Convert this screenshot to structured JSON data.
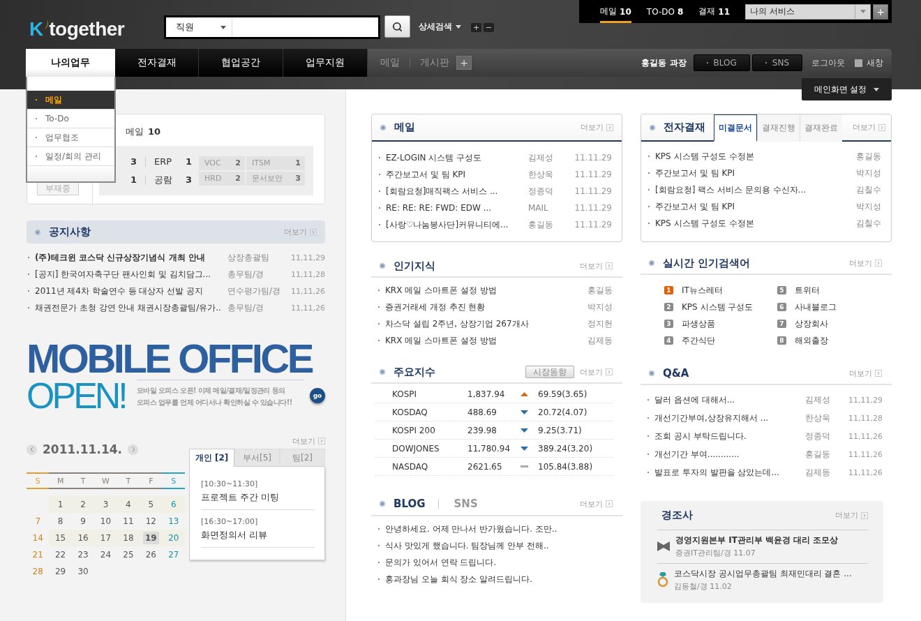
{
  "header": {
    "logo": {
      "mark": "K",
      "name": "together"
    },
    "search": {
      "scope": "직원"
    },
    "detail_search": "상세검색",
    "zoom_buttons": [
      "+",
      "−"
    ],
    "counters": [
      {
        "label": "메일",
        "count": "10",
        "selected": true
      },
      {
        "label": "TO-DO",
        "count": "8",
        "selected": false
      },
      {
        "label": "결재",
        "count": "11",
        "selected": false
      }
    ],
    "service_select": "나의 서비스",
    "service_add": "+"
  },
  "nav": {
    "tabs": [
      {
        "label": "나의업무",
        "selected": true
      },
      {
        "label": "전자결재",
        "selected": false
      },
      {
        "label": "협업공간",
        "selected": false
      },
      {
        "label": "업무지원",
        "selected": false
      }
    ],
    "quick_links": [
      "메일",
      "게시판"
    ],
    "quick_add": "+",
    "user": "홍길동 과장",
    "user_buttons": [
      "BLOG",
      "SNS"
    ],
    "logout": "로그아웃",
    "new_window": {
      "label": "새창",
      "checked": false
    },
    "main_settings": "메인화면 설정"
  },
  "dropdown": {
    "items": [
      {
        "label": "메일",
        "selected": true
      },
      {
        "label": "To-Do",
        "selected": false
      },
      {
        "label": "업무협조",
        "selected": false
      },
      {
        "label": "일정/회의 관리",
        "selected": false
      }
    ]
  },
  "mail_summary": {
    "title": "메일",
    "count": "10",
    "away_button": "부재중",
    "stats": [
      [
        {
          "value": "3"
        },
        {
          "label": "ERP",
          "value": "1"
        }
      ],
      [
        {
          "value": "1"
        },
        {
          "label": "공람",
          "value": "3"
        }
      ]
    ],
    "boxes": [
      {
        "label": "VOC",
        "value": "2"
      },
      {
        "label": "ITSM",
        "value": "1"
      },
      {
        "label": "HRD",
        "value": "2"
      },
      {
        "label": "문서보안",
        "value": "3"
      }
    ]
  },
  "notices": {
    "title": "공지사항",
    "more": "더보기",
    "rows": [
      {
        "title": "(주)테크윈 코스닥 신규상장기념식 개최 안내",
        "dept": "상장총괄팀",
        "date": "11,11,29",
        "bold": true
      },
      {
        "title": "[공지] 한국여자축구단 팬사인회 및 김치담그...",
        "dept": "총무팀/경",
        "date": "11,11,28",
        "bold": false
      },
      {
        "title": "2011년 제4차 학술연수 등 대상자 선발 공지",
        "dept": "연수평가팀/경",
        "date": "11,11,26",
        "bold": false
      },
      {
        "title": "채권전문가 초청 강연 안내 채권시장총괄팀/유가..",
        "dept": "총무팀/경",
        "date": "11,11,26",
        "bold": false
      }
    ]
  },
  "banner": {
    "headline": "MOBILE OFFICE",
    "subhead": "OPEN!",
    "lines": [
      "모바일 오피스 오픈! 이제 메일/결재/일정관리 등의",
      "오피스 업무를 언제 어디서나 확인하실 수 있습니다!!"
    ],
    "go": "go"
  },
  "calendar": {
    "date": "2011.11.14.",
    "more": "더보기",
    "weekdays": [
      {
        "label": "S",
        "kind": "sun"
      },
      {
        "label": "M",
        "kind": "day"
      },
      {
        "label": "T",
        "kind": "day"
      },
      {
        "label": "W",
        "kind": "day"
      },
      {
        "label": "T",
        "kind": "day"
      },
      {
        "label": "F",
        "kind": "day"
      },
      {
        "label": "S",
        "kind": "sat"
      }
    ],
    "weeks": [
      {
        "shaded": true,
        "days": [
          {
            "day": "1",
            "today": false
          },
          {
            "day": "2",
            "today": false
          },
          {
            "day": "3",
            "today": false
          },
          {
            "day": "4",
            "today": false
          },
          {
            "day": "5",
            "today": false
          },
          {
            "day": "6",
            "today": false
          }
        ]
      },
      {
        "shaded": false,
        "days": [
          {
            "day": "7",
            "today": false
          },
          {
            "day": "8",
            "today": false
          },
          {
            "day": "9",
            "today": false
          },
          {
            "day": "10",
            "today": false
          },
          {
            "day": "11",
            "today": false
          },
          {
            "day": "12",
            "today": false
          },
          {
            "day": "13",
            "today": false
          }
        ]
      },
      {
        "shaded": true,
        "days": [
          {
            "day": "14",
            "today": false
          },
          {
            "day": "15",
            "today": false
          },
          {
            "day": "16",
            "today": false
          },
          {
            "day": "17",
            "today": false
          },
          {
            "day": "18",
            "today": false
          },
          {
            "day": "19",
            "today": true
          },
          {
            "day": "20",
            "today": false
          }
        ]
      },
      {
        "shaded": false,
        "days": [
          {
            "day": "21",
            "today": false
          },
          {
            "day": "22",
            "today": false
          },
          {
            "day": "23",
            "today": false
          },
          {
            "day": "24",
            "today": false
          },
          {
            "day": "25",
            "today": false
          },
          {
            "day": "26",
            "today": false
          },
          {
            "day": "27",
            "today": false
          }
        ]
      },
      {
        "shaded": false,
        "days": [
          {
            "day": "28",
            "today": false
          },
          {
            "day": "29",
            "today": false
          },
          {
            "day": "30",
            "today": false
          }
        ]
      }
    ]
  },
  "schedule": {
    "tabs": [
      {
        "label": "개인 [2]",
        "selected": true
      },
      {
        "label": "부서[5]",
        "selected": false
      },
      {
        "label": "팀[2]",
        "selected": false
      }
    ],
    "events": [
      {
        "time": "[10:30~11:30]",
        "title": "프로젝트 주간 미팅"
      },
      {
        "time": "[16:30~17:00]",
        "title": "화면정의서 리뷰"
      }
    ]
  },
  "mail": {
    "title": "메일",
    "more": "더보기",
    "rows": [
      {
        "title": "EZ-LOGIN 시스템 구성도",
        "sender": "김제성",
        "date": "11.11.29"
      },
      {
        "title": "주간보고서 및 팀 KPI",
        "sender": "한상욱",
        "date": "11.11.29"
      },
      {
        "title": "[회람요청]매직팩스 서비스  ...",
        "sender": "정종덕",
        "date": "11.11.29"
      },
      {
        "title": "RE: RE: RE: FWD: EDW ...",
        "sender": "MAIL",
        "date": "11.11.29"
      },
      {
        "title": "[사랑♡나눔봉사단]커뮤니티에...",
        "sender": "홍길동",
        "date": "11.11.29"
      }
    ]
  },
  "knowledge": {
    "title": "인기지식",
    "more": "더보기",
    "rows": [
      {
        "title": "KRX 메일 스마트폰 설정 방법",
        "author": "홍길동"
      },
      {
        "title": "증권거래세 개정 추진 현황",
        "author": "박지성"
      },
      {
        "title": "차스닥 설립 2주년, 상장기업 267개사",
        "author": "정지헌"
      },
      {
        "title": "KRX 메일 스마트폰 설정 방법",
        "author": "김제동"
      }
    ]
  },
  "indices": {
    "title": "주요지수",
    "button": "시장동향",
    "more": "더보기",
    "rows": [
      {
        "name": "KOSPI",
        "value": "1,837.94",
        "kind": "up",
        "change": "69.59(3.65)"
      },
      {
        "name": "KOSDAQ",
        "value": "488.69",
        "kind": "down",
        "change": "20.72(4.07)"
      },
      {
        "name": "KOSPI 200",
        "value": "239.98",
        "kind": "down",
        "change": "9.25(3.71)"
      },
      {
        "name": "DOWJONES",
        "value": "11,780.94",
        "kind": "down",
        "change": "389.24(3.20)"
      },
      {
        "name": "NASDAQ",
        "value": "2621.65",
        "kind": "flat",
        "change": "105.84(3.88)"
      }
    ]
  },
  "social": {
    "tabs": [
      {
        "label": "BLOG",
        "selected": true
      },
      {
        "label": "SNS",
        "selected": false
      }
    ],
    "more": "더보기",
    "rows": [
      "안녕하세요. 어제 만나서 반가웠습니다. 조만..",
      "식사 맛있게 했습니다. 팀장님께 안부 전해..",
      "문의가 있어서 연락 드립니다.",
      "홍과장님 오늘 회식 장소 알려드립니다."
    ]
  },
  "approval": {
    "title": "전자결재",
    "tabs": [
      {
        "label": "미결문서",
        "selected": true
      },
      {
        "label": "결재진행",
        "selected": false
      },
      {
        "label": "결재완료",
        "selected": false
      }
    ],
    "more": "더보기",
    "rows": [
      {
        "title": "KPS 시스템 구성도 수정본",
        "name": "홍길동"
      },
      {
        "title": "주간보고서 및 팀 KPI",
        "name": "박지성"
      },
      {
        "title": "[회람요청] 팩스 서비스 문의용 수신자...",
        "name": "김칠수"
      },
      {
        "title": "주간보고서 및 팀 KPI",
        "name": "박지성"
      },
      {
        "title": "KPS 시스템 구성도 수정본",
        "name": "김칠수"
      }
    ]
  },
  "trending": {
    "title": "실시간 인기검색어",
    "more": "더보기",
    "items": [
      {
        "rank": "1",
        "term": "IT뉴스레터",
        "highlighted": true
      },
      {
        "rank": "2",
        "term": "KPS 시스템 구성도",
        "highlighted": false
      },
      {
        "rank": "3",
        "term": "파생상품",
        "highlighted": false
      },
      {
        "rank": "4",
        "term": "주간식단",
        "highlighted": false
      },
      {
        "rank": "5",
        "term": "트위터",
        "highlighted": false
      },
      {
        "rank": "6",
        "term": "사내블로그",
        "highlighted": false
      },
      {
        "rank": "7",
        "term": "상장회사",
        "highlighted": false
      },
      {
        "rank": "8",
        "term": "해외출장",
        "highlighted": false
      }
    ]
  },
  "qa": {
    "title": "Q&A",
    "more": "더보기",
    "rows": [
      {
        "title": "달러 옵션에 대해서...",
        "name": "김제성",
        "date": "11,11,29"
      },
      {
        "title": "개선기간부여,상장유지해서 ...",
        "name": "한상욱",
        "date": "11,11,28"
      },
      {
        "title": "조회 공시 부탁드립니다.",
        "name": "정종덕",
        "date": "11,11,26"
      },
      {
        "title": "개선기간 부여............",
        "name": "홍길동",
        "date": "11,11,26"
      },
      {
        "title": "발표로 투자의 발판을 삼았는데...",
        "name": "김제동",
        "date": "11,11,26"
      }
    ]
  },
  "occasions": {
    "title": "경조사",
    "more": "더보기",
    "items": [
      {
        "kind": "condolence",
        "title": "경영지원본부 IT관리부 백윤경 대리 조모상",
        "meta": "증권IT관리팀/경 11.07",
        "bold": true
      },
      {
        "kind": "wedding",
        "title": "코스닥시장 공시업무총괄팀 최재민대리 결혼 ...",
        "meta": "김동철/경 11.02",
        "bold": false
      }
    ]
  }
}
